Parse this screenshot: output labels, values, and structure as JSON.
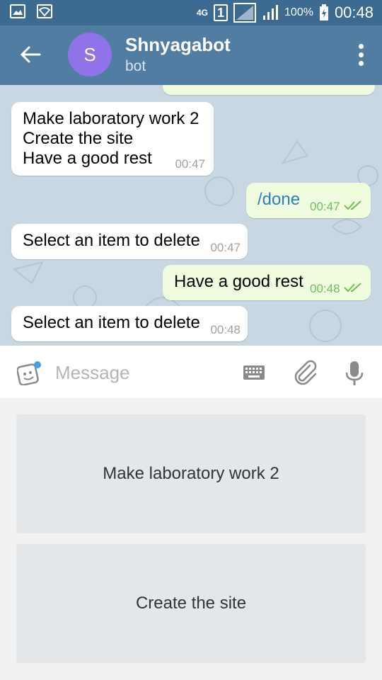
{
  "status_bar": {
    "network_type": "4G",
    "sim_slot": "1",
    "battery": "100%",
    "time": "00:48"
  },
  "header": {
    "avatar_letter": "S",
    "title": "Shnyagabot",
    "subtitle": "bot"
  },
  "messages": [
    {
      "direction": "in",
      "text": "Make laboratory work 2\nCreate the site\nHave a good rest",
      "time": "00:47"
    },
    {
      "direction": "out",
      "text": "/done",
      "time": "00:47",
      "read": true
    },
    {
      "direction": "in",
      "text": "Select an item to delete",
      "time": "00:47"
    },
    {
      "direction": "out",
      "text": "Have a good rest",
      "time": "00:48",
      "read": true
    },
    {
      "direction": "in",
      "text": "Select an item to delete",
      "time": "00:48"
    }
  ],
  "input": {
    "placeholder": "Message"
  },
  "bot_keyboard": {
    "buttons": [
      "Make laboratory work 2",
      "Create the site"
    ]
  },
  "colors": {
    "header": "#517da2",
    "status_bar": "#3d6a91",
    "incoming_bubble": "#ffffff",
    "outgoing_bubble": "#effdde",
    "avatar": "#8f73e8"
  }
}
